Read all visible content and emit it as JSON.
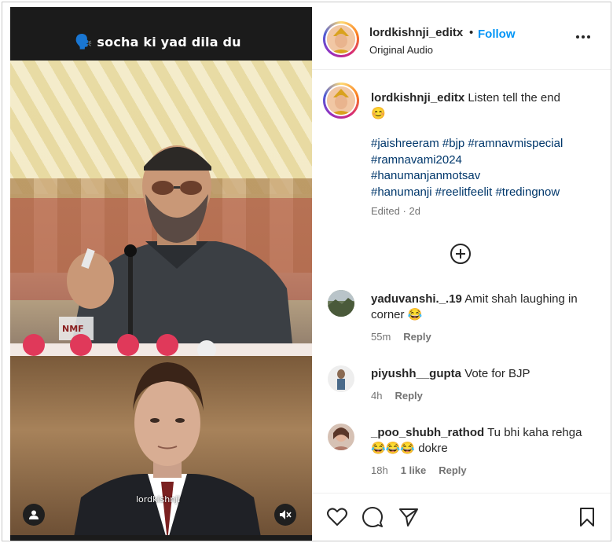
{
  "media": {
    "overlay_caption": "socha ki yad dila du",
    "speech_emoji": "🗣️",
    "stage_badge": "NMF",
    "watermark": "lordkishnji",
    "user_icon": "user-icon",
    "mute_icon": "speaker-muted-icon"
  },
  "header": {
    "username": "lordkishnji_editx",
    "separator": "•",
    "follow_label": "Follow",
    "audio_label": "Original Audio",
    "more_icon": "more-horizontal-icon"
  },
  "caption": {
    "username": "lordkishnji_editx",
    "text": "Listen tell the end",
    "emoji": "😊",
    "hashtags": [
      "#jaishreeram",
      "#bjp",
      "#ramnavmispecial",
      "#ramnavami2024",
      "#hanumanjanmotsav",
      "#hanumanji",
      "#reelitfeelit",
      "#tredingnow"
    ],
    "edited_label": "Edited",
    "edited_sep": "·",
    "edited_time": "2d"
  },
  "load_more_icon": "plus-circle-icon",
  "comments": [
    {
      "username": "yaduvanshi._.19",
      "text": "Amit shah laughing in corner 😂",
      "time": "55m",
      "likes": "",
      "reply_label": "Reply"
    },
    {
      "username": "piyushh__gupta",
      "text": "Vote for BJP",
      "time": "4h",
      "likes": "",
      "reply_label": "Reply"
    },
    {
      "username": "_poo_shubh_rathod",
      "text": "Tu bhi kaha rehga 😂😂😂 dokre",
      "time": "18h",
      "likes": "1 like",
      "reply_label": "Reply"
    }
  ],
  "actions": {
    "like_icon": "heart-icon",
    "comment_icon": "comment-icon",
    "share_icon": "send-icon",
    "save_icon": "bookmark-icon"
  },
  "colors": {
    "follow": "#0095f6",
    "hashtag": "#00376b",
    "muted_text": "#737373"
  }
}
